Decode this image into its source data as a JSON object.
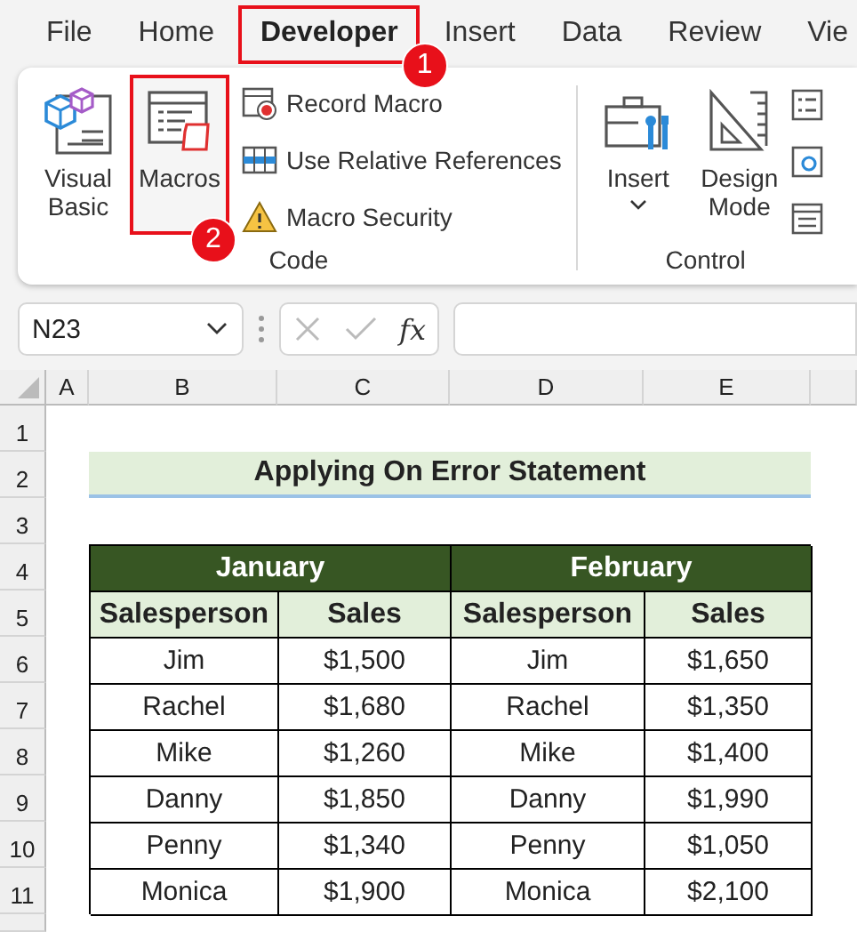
{
  "ribbon_tabs": [
    {
      "label": "File",
      "selected": false,
      "highlighted": false
    },
    {
      "label": "Home",
      "selected": false,
      "highlighted": false
    },
    {
      "label": "Developer",
      "selected": true,
      "highlighted": true,
      "callout": "1"
    },
    {
      "label": "Insert",
      "selected": false,
      "highlighted": false
    },
    {
      "label": "Data",
      "selected": false,
      "highlighted": false
    },
    {
      "label": "Review",
      "selected": false,
      "highlighted": false
    },
    {
      "label": "Vie",
      "selected": false,
      "highlighted": false
    }
  ],
  "ribbon_groups": [
    {
      "label": "Code",
      "large_buttons": [
        {
          "kind": "visual-basic",
          "label": "Visual Basic",
          "highlighted": false,
          "dropdown": false
        },
        {
          "kind": "macros",
          "label": "Macros",
          "highlighted": true,
          "dropdown": false,
          "callout": "2"
        }
      ],
      "small_buttons": [
        {
          "kind": "record",
          "label": "Record Macro"
        },
        {
          "kind": "relative",
          "label": "Use Relative References"
        },
        {
          "kind": "security",
          "label": "Macro Security"
        }
      ]
    },
    {
      "label": "Control",
      "large_buttons": [
        {
          "kind": "insert",
          "label": "Insert",
          "highlighted": false,
          "dropdown": true
        },
        {
          "kind": "design",
          "label": "Design Mode",
          "highlighted": false,
          "dropdown": false
        }
      ],
      "small_icons": [
        {
          "kind": "properties"
        },
        {
          "kind": "view-code"
        },
        {
          "kind": "dialog"
        }
      ]
    }
  ],
  "formula_bar": {
    "name_box": "N23",
    "function_label": "fx"
  },
  "sheet": {
    "column_headers": [
      "A",
      "B",
      "C",
      "D",
      "E"
    ],
    "row_headers": [
      "1",
      "2",
      "3",
      "4",
      "5",
      "6",
      "7",
      "8",
      "9",
      "10",
      "11"
    ],
    "title": "Applying On Error Statement",
    "table": {
      "groups": [
        "January",
        "February"
      ],
      "columns": [
        "Salesperson",
        "Sales",
        "Salesperson",
        "Sales"
      ],
      "rows": [
        [
          "Jim",
          "$1,500",
          "Jim",
          "$1,650"
        ],
        [
          "Rachel",
          "$1,680",
          "Rachel",
          "$1,350"
        ],
        [
          "Mike",
          "$1,260",
          "Mike",
          "$1,400"
        ],
        [
          "Danny",
          "$1,850",
          "Danny",
          "$1,990"
        ],
        [
          "Penny",
          "$1,340",
          "Penny",
          "$1,050"
        ],
        [
          "Monica",
          "$1,900",
          "Monica",
          "$2,100"
        ]
      ]
    }
  }
}
